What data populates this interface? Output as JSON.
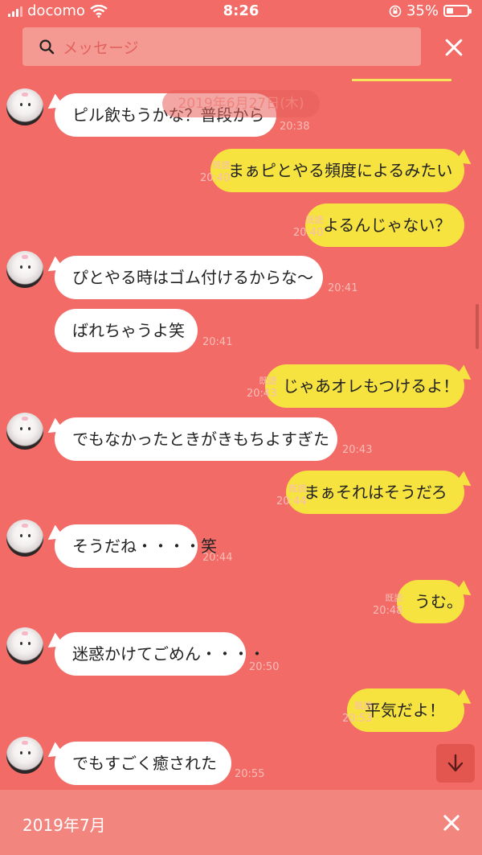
{
  "status": {
    "carrier": "docomo",
    "time": "8:26",
    "battery": "35%",
    "battery_level": 0.35
  },
  "search": {
    "placeholder": "メッセージ"
  },
  "date_pill": "2019年6月27日(木)",
  "messages": [
    {
      "dir": "in",
      "text": "ピル飲もうかな？普段から",
      "time": "20:38"
    },
    {
      "dir": "out",
      "text": "まぁピとやる頻度によるみたい",
      "time": "20:40",
      "read": "既読"
    },
    {
      "dir": "out",
      "text": "よるんじゃない？",
      "time": "20:40",
      "read": "既読"
    },
    {
      "dir": "in",
      "text": "ぴとやる時はゴム付けるからな〜",
      "time": "20:41"
    },
    {
      "dir": "in",
      "text": "ばれちゃうよ笑",
      "time": "20:41"
    },
    {
      "dir": "out",
      "text": "じゃあオレもつけるよ！",
      "time": "20:43",
      "read": "既読"
    },
    {
      "dir": "in",
      "text": "でもなかったときがきもちよすぎた",
      "time": "20:43"
    },
    {
      "dir": "out",
      "text": "まぁそれはそうだろ",
      "time": "20:44",
      "read": "既読"
    },
    {
      "dir": "in",
      "text": "そうだね・・・・笑",
      "time": "20:44"
    },
    {
      "dir": "out",
      "text": "うむ。",
      "time": "20:48",
      "read": "既読"
    },
    {
      "dir": "in",
      "text": "迷惑かけてごめん・・・・",
      "time": "20:50"
    },
    {
      "dir": "out",
      "text": "平気だよ！",
      "time": "20:53",
      "read": "既読"
    },
    {
      "dir": "in",
      "text": "でもすごく癒された",
      "time": "20:55"
    }
  ],
  "bottom_bar": {
    "month": "2019年7月"
  },
  "icons": {
    "search": "search-icon",
    "close": "close-icon",
    "scroll_down": "arrow-down-icon",
    "wifi": "wifi-icon",
    "rotation_lock": "rotation-lock-icon",
    "battery": "battery-icon"
  },
  "colors": {
    "background": "#f26b66",
    "incoming_bubble": "#ffffff",
    "outgoing_bubble": "#f6e33f"
  }
}
